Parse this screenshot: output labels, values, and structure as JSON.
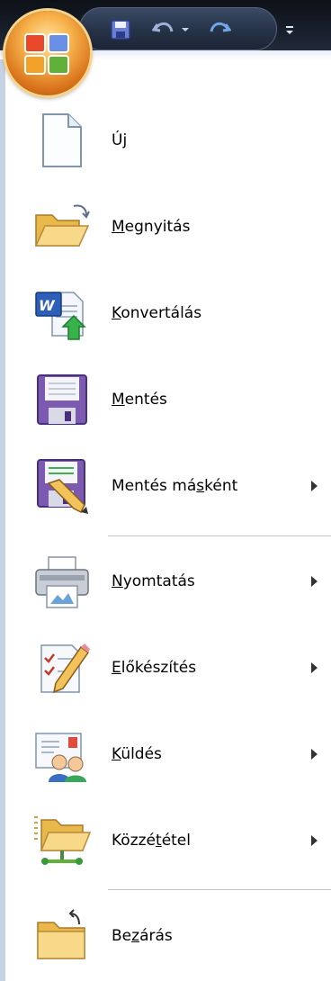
{
  "app": {
    "office_button_icon": "office-logo-icon"
  },
  "quick_access": {
    "save_icon": "save-icon",
    "undo_icon": "undo-icon",
    "undo_dropdown_icon": "chevron-down-icon",
    "redo_icon": "redo-icon",
    "customize_icon": "customize-toolbar-icon"
  },
  "menu": {
    "items": [
      {
        "id": "new",
        "label": "Új",
        "mnemonic_index": 1,
        "icon": "new-document-icon",
        "has_submenu": false
      },
      {
        "id": "open",
        "label": "Megnyitás",
        "mnemonic_index": 0,
        "icon": "open-folder-icon",
        "has_submenu": false
      },
      {
        "id": "convert",
        "label": "Konvertálás",
        "mnemonic_index": 0,
        "icon": "convert-document-icon",
        "has_submenu": false
      },
      {
        "id": "save",
        "label": "Mentés",
        "mnemonic_index": 0,
        "icon": "save-icon",
        "has_submenu": false
      },
      {
        "id": "save-as",
        "label": "Mentés másként",
        "mnemonic_index": 9,
        "icon": "save-as-icon",
        "has_submenu": true
      },
      {
        "id": "print",
        "label": "Nyomtatás",
        "mnemonic_index": 0,
        "icon": "printer-icon",
        "has_submenu": true
      },
      {
        "id": "prepare",
        "label": "Előkészítés",
        "mnemonic_index": 0,
        "icon": "prepare-document-icon",
        "has_submenu": true
      },
      {
        "id": "send",
        "label": "Küldés",
        "mnemonic_index": 0,
        "icon": "send-mail-icon",
        "has_submenu": true
      },
      {
        "id": "publish",
        "label": "Közzététel",
        "mnemonic_index": 5,
        "icon": "publish-folder-icon",
        "has_submenu": true
      },
      {
        "id": "close",
        "label": "Bezárás",
        "mnemonic_index": 2,
        "icon": "close-folder-icon",
        "has_submenu": false
      }
    ]
  },
  "colors": {
    "title_bar": "#1b2230",
    "menu_border": "#c6d3e4",
    "orb": "#f7b24a",
    "separator": "#c5c5c5"
  }
}
